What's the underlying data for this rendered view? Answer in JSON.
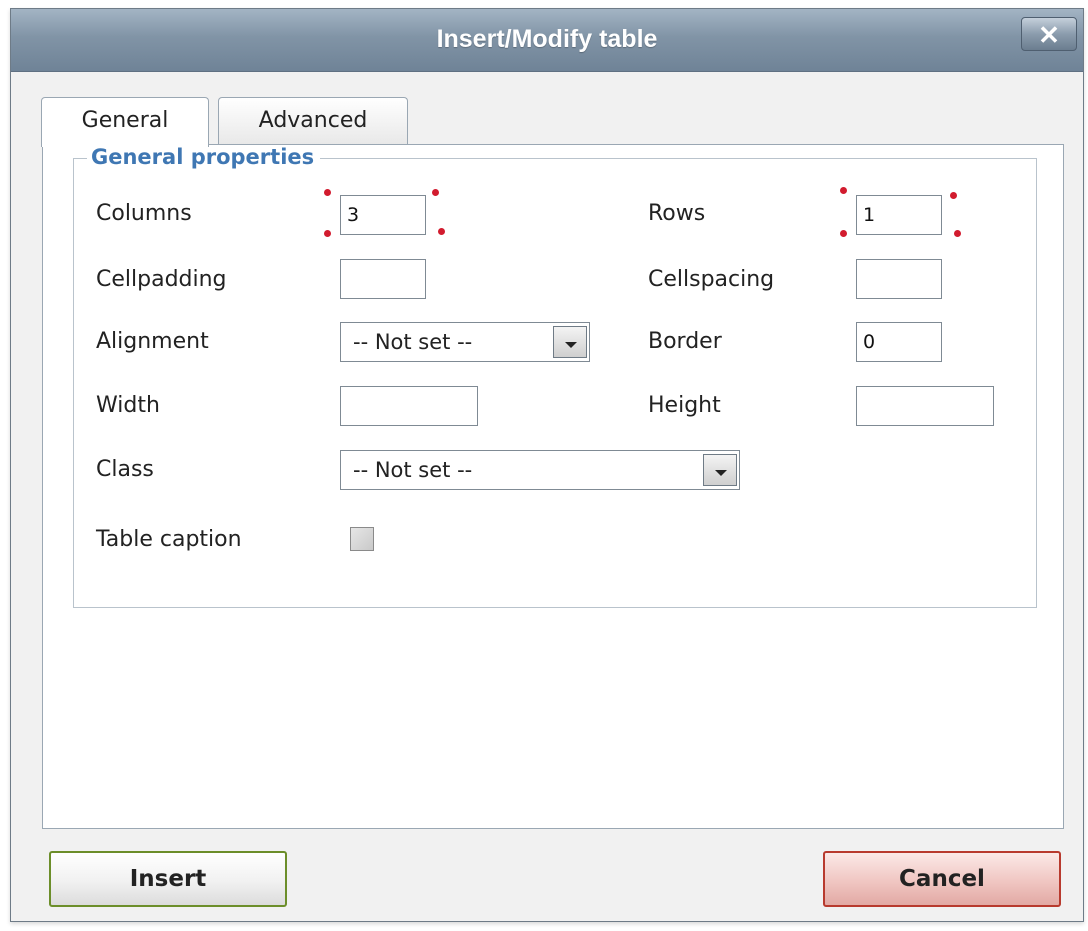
{
  "dialog": {
    "title": "Insert/Modify table",
    "close_label": "✕"
  },
  "tabs": [
    {
      "label": "General",
      "active": true
    },
    {
      "label": "Advanced",
      "active": false
    }
  ],
  "general": {
    "legend": "General properties",
    "columns": {
      "label": "Columns",
      "value": "3",
      "required": true
    },
    "rows": {
      "label": "Rows",
      "value": "1",
      "required": true
    },
    "cellpadding": {
      "label": "Cellpadding",
      "value": ""
    },
    "cellspacing": {
      "label": "Cellspacing",
      "value": ""
    },
    "alignment": {
      "label": "Alignment",
      "value": "-- Not set --"
    },
    "border": {
      "label": "Border",
      "value": "0"
    },
    "width": {
      "label": "Width",
      "value": ""
    },
    "height": {
      "label": "Height",
      "value": ""
    },
    "class": {
      "label": "Class",
      "value": "-- Not set --"
    },
    "caption": {
      "label": "Table caption",
      "checked": false
    }
  },
  "buttons": {
    "insert": "Insert",
    "cancel": "Cancel"
  },
  "colors": {
    "title_bar": "#8194a6",
    "legend_text": "#3f77b3",
    "required_dot": "#d21b2e",
    "insert_border": "#6c8e2a",
    "cancel_border": "#b83a2e"
  },
  "icons": {
    "close": "close-icon",
    "dropdown": "chevron-down-icon"
  }
}
